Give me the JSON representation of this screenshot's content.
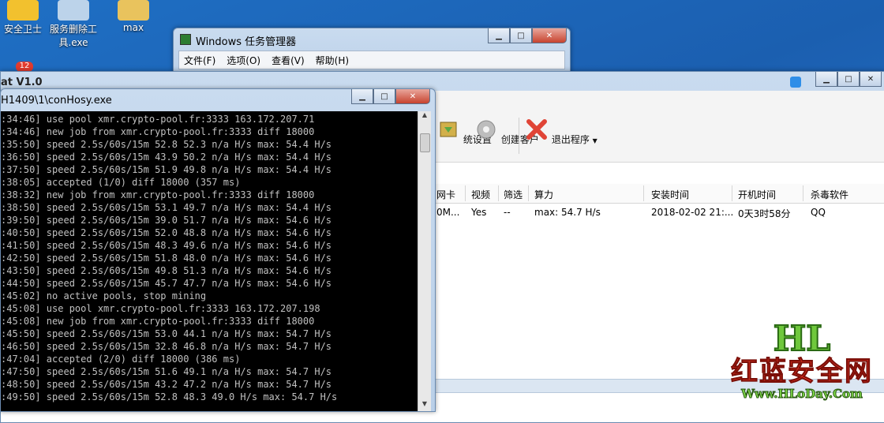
{
  "desktop": {
    "icons": [
      {
        "label": "安全卫士"
      },
      {
        "label": "服务删除工具.exe"
      },
      {
        "label": "max"
      }
    ],
    "badge": "12"
  },
  "taskmgr": {
    "title": "Windows 任务管理器",
    "menu": [
      "文件(F)",
      "选项(O)",
      "查看(V)",
      "帮助(H)"
    ]
  },
  "rat": {
    "title": "at  V1.0",
    "toolbar": {
      "system_settings": "统设置",
      "create_client": "创建客户",
      "exit": "退出程序"
    },
    "columns": [
      "网卡",
      "视频",
      "筛选",
      "算力",
      "安装时间",
      "开机时间",
      "杀毒软件"
    ],
    "row": [
      "0M...",
      "Yes",
      "--",
      "max: 54.7 H/s",
      "2018-02-02 21:...",
      "0天3时58分",
      "QQ"
    ]
  },
  "console": {
    "title": "H1409\\1\\conHosy.exe",
    "lines": [
      ":34:46] use pool xmr.crypto-pool.fr:3333 163.172.207.71",
      ":34:46] new job from xmr.crypto-pool.fr:3333 diff 18000",
      ":35:50] speed 2.5s/60s/15m 52.8 52.3 n/a H/s max: 54.4 H/s",
      ":36:50] speed 2.5s/60s/15m 43.9 50.2 n/a H/s max: 54.4 H/s",
      ":37:50] speed 2.5s/60s/15m 51.9 49.8 n/a H/s max: 54.4 H/s",
      ":38:05] accepted (1/0) diff 18000 (357 ms)",
      ":38:32] new job from xmr.crypto-pool.fr:3333 diff 18000",
      ":38:50] speed 2.5s/60s/15m 53.1 49.7 n/a H/s max: 54.4 H/s",
      ":39:50] speed 2.5s/60s/15m 39.0 51.7 n/a H/s max: 54.6 H/s",
      ":40:50] speed 2.5s/60s/15m 52.0 48.8 n/a H/s max: 54.6 H/s",
      ":41:50] speed 2.5s/60s/15m 48.3 49.6 n/a H/s max: 54.6 H/s",
      ":42:50] speed 2.5s/60s/15m 51.8 48.0 n/a H/s max: 54.6 H/s",
      ":43:50] speed 2.5s/60s/15m 49.8 51.3 n/a H/s max: 54.6 H/s",
      ":44:50] speed 2.5s/60s/15m 45.7 47.7 n/a H/s max: 54.6 H/s",
      ":45:02] no active pools, stop mining",
      ":45:08] use pool xmr.crypto-pool.fr:3333 163.172.207.198",
      ":45:08] new job from xmr.crypto-pool.fr:3333 diff 18000",
      ":45:50] speed 2.5s/60s/15m 53.0 44.1 n/a H/s max: 54.7 H/s",
      ":46:50] speed 2.5s/60s/15m 32.8 46.8 n/a H/s max: 54.7 H/s",
      ":47:04] accepted (2/0) diff 18000 (386 ms)",
      ":47:50] speed 2.5s/60s/15m 51.6 49.1 n/a H/s max: 54.7 H/s",
      ":48:50] speed 2.5s/60s/15m 43.2 47.2 n/a H/s max: 54.7 H/s",
      ":49:50] speed 2.5s/60s/15m 52.8 48.3 49.0 H/s max: 54.7 H/s"
    ]
  },
  "watermark": {
    "logo": "HL",
    "name": "红蓝安全网",
    "url": "Www.HLoDay.Com"
  }
}
